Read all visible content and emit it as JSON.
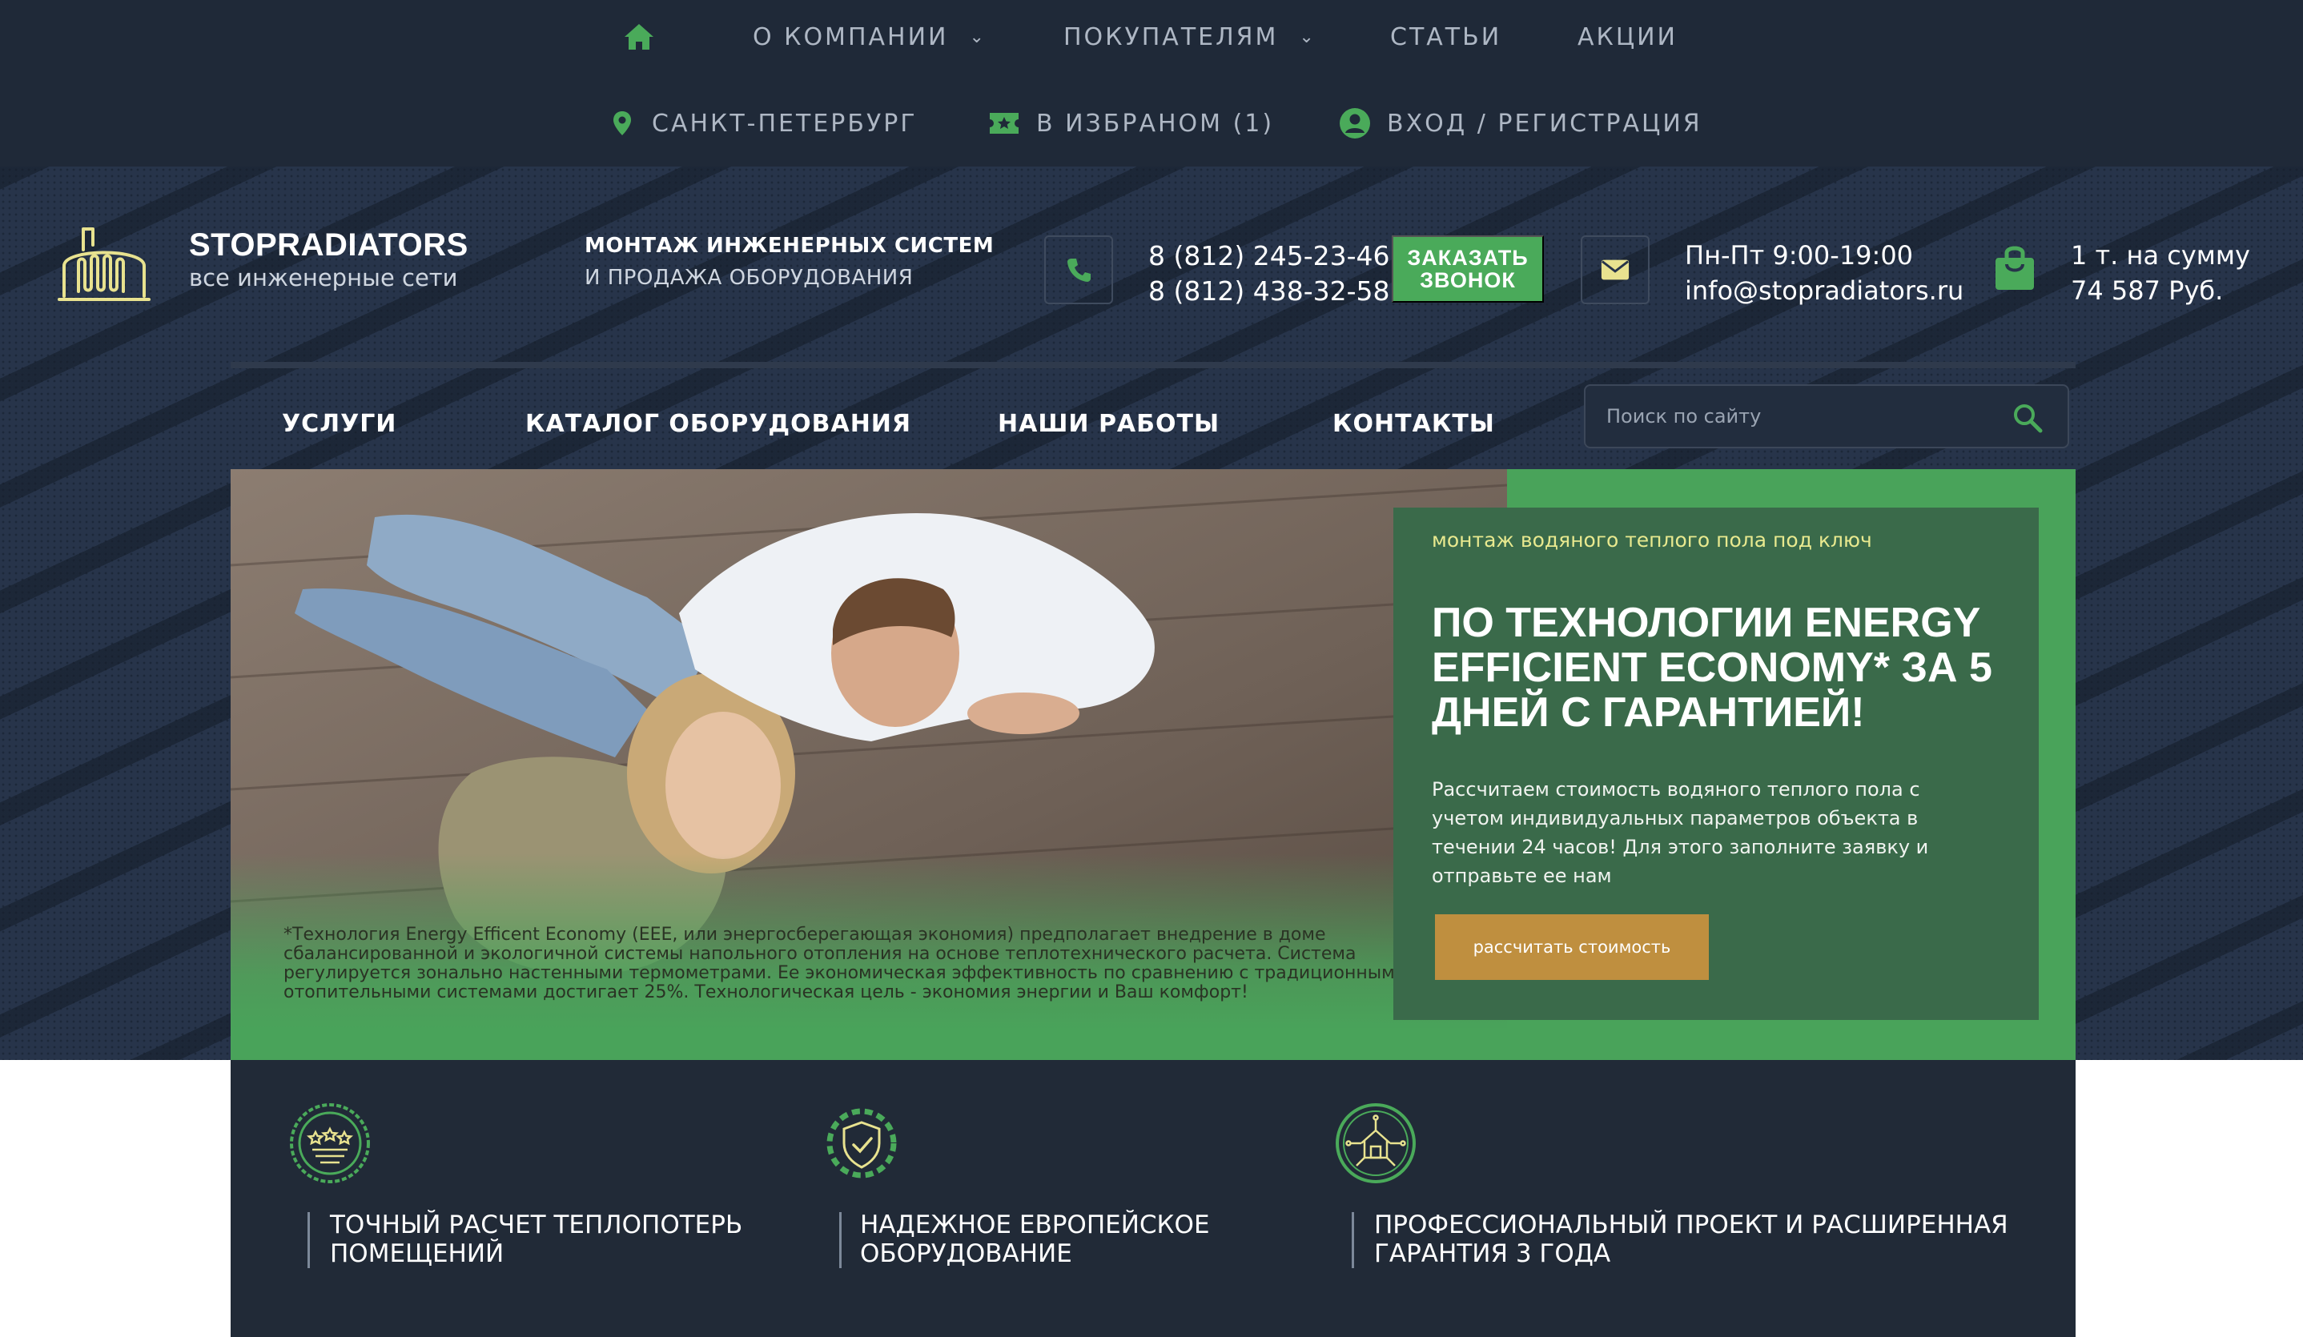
{
  "topnav": {
    "home_icon": "home-icon",
    "items": [
      {
        "label": "О КОМПАНИИ",
        "dropdown": true
      },
      {
        "label": "ПОКУПАТЕЛЯМ",
        "dropdown": true
      },
      {
        "label": "СТАТЬИ",
        "dropdown": false
      },
      {
        "label": "АКЦИИ",
        "dropdown": false
      }
    ],
    "city": "САНКТ-ПЕТЕРБУРГ",
    "favorites": "В ИЗБРАНОМ (1)",
    "login": "ВХОД / РЕГИСТРАЦИЯ"
  },
  "brand": {
    "name": "STOPRADIATORS",
    "tagline": "все инженерные сети",
    "slogan_line1": "МОНТАЖ ИНЖЕНЕРНЫХ СИСТЕМ",
    "slogan_line2": "И ПРОДАЖА ОБОРУДОВАНИЯ"
  },
  "contacts": {
    "phone1": "8 (812) 245-23-46",
    "phone2": "8 (812) 438-32-58",
    "call_button": "ЗАКАЗАТЬ ЗВОНОК",
    "hours": "Пн-Пт 9:00-19:00",
    "email": "info@stopradiators.ru"
  },
  "cart": {
    "line1": "1 т. на сумму",
    "line2": "74 587 Руб."
  },
  "mainnav": {
    "items": [
      "УСЛУГИ",
      "КАТАЛОГ ОБОРУДОВАНИЯ",
      "НАШИ РАБОТЫ",
      "КОНТАКТЫ"
    ],
    "search_placeholder": "Поиск по сайту"
  },
  "hero": {
    "kicker": "монтаж водяного теплого пола под ключ",
    "title": "ПО ТЕХНОЛОГИИ ENERGY EFFICIENT ECONOMY* ЗА 5 ДНЕЙ С ГАРАНТИЕЙ!",
    "text": "Рассчитаем стоимость водяного теплого пола с учетом индивидуальных параметров объекта в течении 24 часов! Для этого заполните заявку и отправьте ее нам",
    "button": "рассчитать стоимость",
    "disclaimer": "*Технология Energy Efficent Economy (EEE, или энергосберегающая экономия) предполагает внедрение в доме сбалансированной и экологичной системы напольного отопления на основе теплотехнического расчета. Система регулируется зонально настенными термометрами. Ее экономическая эффективность по сравнению с традиционными отопительными системами достигает 25%. Технологическая цель - экономия энергии и Ваш комфорт!"
  },
  "features": [
    {
      "icon": "stars-badge-icon",
      "label": "ТОЧНЫЙ РАСЧЕТ ТЕПЛОПОТЕРЬ ПОМЕЩЕНИЙ"
    },
    {
      "icon": "shield-check-icon",
      "label": "НАДЕЖНОЕ ЕВРОПЕЙСКОЕ ОБОРУДОВАНИЕ"
    },
    {
      "icon": "house-network-icon",
      "label": "ПРОФЕССИОНАЛЬНЫЙ ПРОЕКТ И РАСШИРЕННАЯ ГАРАНТИЯ 3 ГОДА"
    }
  ],
  "colors": {
    "accent_green": "#4aaa5a",
    "dark_bg": "#1f2938",
    "promo_bg": "#3a6a4a",
    "button_gold": "#bf8f3f",
    "kicker_yellow": "#e8e98f"
  }
}
